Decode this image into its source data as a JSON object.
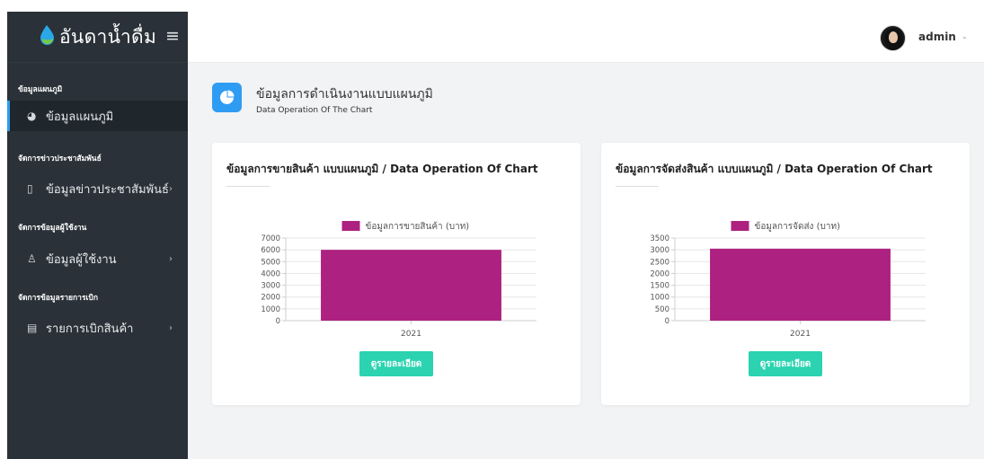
{
  "app": {
    "brand": "อันดาน้ำดื่ม",
    "user": "admin"
  },
  "sidebar": {
    "groups": [
      {
        "title": "ข้อมูลแผนภูมิ",
        "items": [
          {
            "label": "ข้อมูลแผนภูมิ",
            "icon": "pie-icon",
            "active": true,
            "has_children": false
          }
        ]
      },
      {
        "title": "จัดการข่าวประชาสัมพันธ์",
        "items": [
          {
            "label": "ข้อมูลข่าวประชาสัมพันธ์",
            "icon": "tablet-icon",
            "active": false,
            "has_children": true
          }
        ]
      },
      {
        "title": "จัดการข้อมูลผู้ใช้งาน",
        "items": [
          {
            "label": "ข้อมูลผู้ใช้งาน",
            "icon": "user-icon",
            "active": false,
            "has_children": true
          }
        ]
      },
      {
        "title": "จัดการข้อมูลรายการเบิก",
        "items": [
          {
            "label": "รายการเบิกสินค้า",
            "icon": "id-card-icon",
            "active": false,
            "has_children": true
          }
        ]
      }
    ]
  },
  "page": {
    "title": "ข้อมูลการดำเนินงานแบบแผนภูมิ",
    "subtitle": "Data Operation Of The Chart"
  },
  "cards": [
    {
      "title": "ข้อมูลการขายสินค้า แบบแผนภูมิ / Data Operation Of Chart",
      "button": "ดูรายละเอียด"
    },
    {
      "title": "ข้อมูลการจัดส่งสินค้า แบบแผนภูมิ / Data Operation Of Chart",
      "button": "ดูรายละเอียด"
    }
  ],
  "colors": {
    "bar": "#ad2181",
    "accent": "#2f9cf3",
    "button": "#2bd3b0",
    "sidebar": "#2a3138"
  },
  "chart_data": [
    {
      "type": "bar",
      "categories": [
        "2021"
      ],
      "series": [
        {
          "name": "ข้อมูลการขายสินค้า (บาท)",
          "values": [
            6000
          ]
        }
      ],
      "ylim": [
        0,
        7000
      ],
      "yticks": [
        0,
        1000,
        2000,
        3000,
        4000,
        5000,
        6000,
        7000
      ],
      "legend": "top-center",
      "grid": true
    },
    {
      "type": "bar",
      "categories": [
        "2021"
      ],
      "series": [
        {
          "name": "ข้อมูลการจัดส่ง (บาท)",
          "values": [
            3050
          ]
        }
      ],
      "ylim": [
        0,
        3500
      ],
      "yticks": [
        0,
        500,
        1000,
        1500,
        2000,
        2500,
        3000,
        3500
      ],
      "legend": "top-center",
      "grid": true
    }
  ]
}
